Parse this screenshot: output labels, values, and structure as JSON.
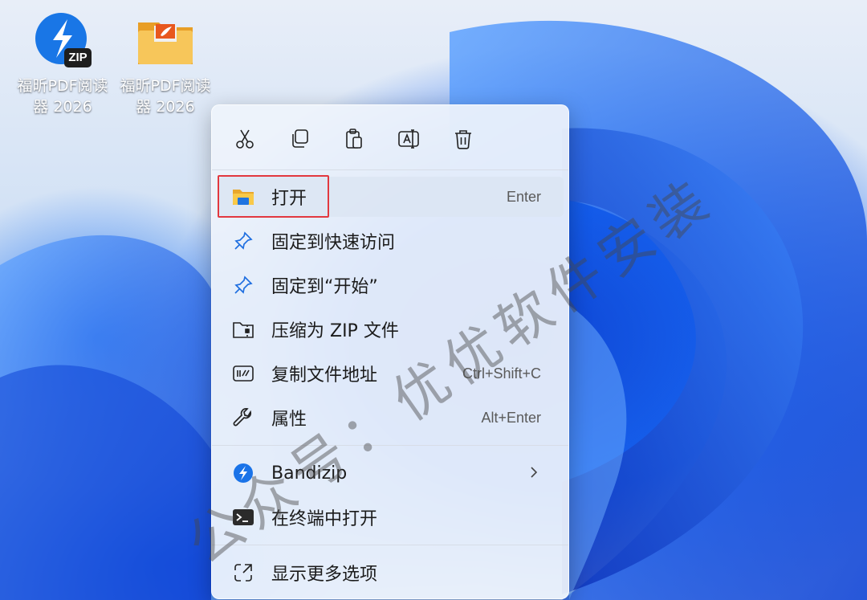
{
  "desktop": {
    "icons": [
      {
        "label_line1": "福昕PDF阅读",
        "label_line2": "器 2026",
        "badge": "ZIP",
        "icon": "bandizip-icon"
      },
      {
        "label_line1": "福昕PDF阅读",
        "label_line2": "器 2026",
        "icon": "folder-foxit-icon"
      }
    ]
  },
  "context_menu": {
    "toolbar": [
      "cut-icon",
      "copy-icon",
      "paste-icon",
      "rename-icon",
      "delete-icon"
    ],
    "items": [
      {
        "label": "打开",
        "shortcut": "Enter",
        "icon": "folder-icon"
      },
      {
        "label": "固定到快速访问",
        "shortcut": "",
        "icon": "pin-icon"
      },
      {
        "label": "固定到“开始”",
        "shortcut": "",
        "icon": "pin-icon"
      },
      {
        "label": "压缩为 ZIP 文件",
        "shortcut": "",
        "icon": "zip-icon"
      },
      {
        "label": "复制文件地址",
        "shortcut": "Ctrl+Shift+C",
        "icon": "copy-path-icon"
      },
      {
        "label": "属性",
        "shortcut": "Alt+Enter",
        "icon": "wrench-icon"
      },
      {
        "label": "Bandizip",
        "shortcut": "",
        "icon": "bandizip-icon",
        "submenu": true
      },
      {
        "label": "在终端中打开",
        "shortcut": "",
        "icon": "terminal-icon"
      },
      {
        "label": "显示更多选项",
        "shortcut": "",
        "icon": "show-more-icon"
      }
    ]
  },
  "watermark": "公众号：优优软件安装",
  "colors": {
    "highlight": "#e2383f",
    "accent": "#1f6bf2",
    "folder": "#f4b73b"
  }
}
